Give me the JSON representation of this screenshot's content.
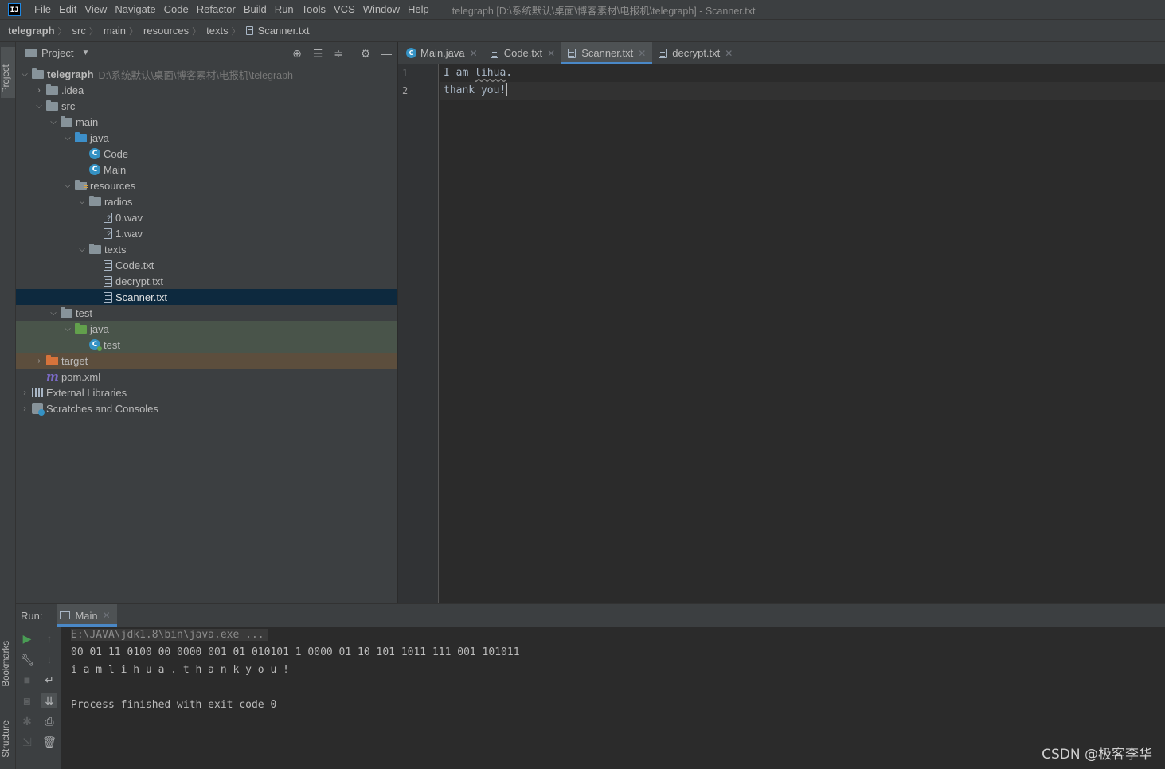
{
  "menubar": {
    "logo": "IJ",
    "items": [
      {
        "u": "F",
        "rest": "ile"
      },
      {
        "u": "E",
        "rest": "dit"
      },
      {
        "u": "V",
        "rest": "iew"
      },
      {
        "u": "N",
        "rest": "avigate"
      },
      {
        "u": "C",
        "rest": "ode"
      },
      {
        "u": "R",
        "rest": "efactor"
      },
      {
        "u": "B",
        "rest": "uild"
      },
      {
        "u": "R",
        "rest": "un",
        "pre": ""
      },
      {
        "u": "T",
        "rest": "ools"
      },
      {
        "u": "",
        "rest": "VCS"
      },
      {
        "u": "W",
        "rest": "indow"
      },
      {
        "u": "H",
        "rest": "elp"
      }
    ],
    "window_title": "telegraph [D:\\系统默认\\桌面\\博客素材\\电报机\\telegraph] - Scanner.txt"
  },
  "breadcrumb": {
    "project": "telegraph",
    "parts": [
      "src",
      "main",
      "resources",
      "texts"
    ],
    "file": "Scanner.txt"
  },
  "left_stripe": {
    "project": "Project",
    "bookmarks": "Bookmarks",
    "structure": "Structure"
  },
  "project_panel": {
    "title": "Project",
    "root_name": "telegraph",
    "root_path": "D:\\系统默认\\桌面\\博客素材\\电报机\\telegraph",
    "tree": {
      "idea": ".idea",
      "src": "src",
      "main": "main",
      "java": "java",
      "code": "Code",
      "main_class": "Main",
      "resources": "resources",
      "radios": "radios",
      "wav0": "0.wav",
      "wav1": "1.wav",
      "texts": "texts",
      "code_txt": "Code.txt",
      "decrypt_txt": "decrypt.txt",
      "scanner_txt": "Scanner.txt",
      "test": "test",
      "test_java": "java",
      "test_class": "test",
      "target": "target",
      "pom": "pom.xml",
      "ext_libs": "External Libraries",
      "scratches": "Scratches and Consoles"
    }
  },
  "editor": {
    "tabs": [
      {
        "label": "Main.java",
        "kind": "class"
      },
      {
        "label": "Code.txt",
        "kind": "file"
      },
      {
        "label": "Scanner.txt",
        "kind": "file",
        "active": true
      },
      {
        "label": "decrypt.txt",
        "kind": "file"
      }
    ],
    "line_numbers": [
      "1",
      "2"
    ],
    "line1_a": "I am ",
    "line1_b": "lihua",
    "line1_c": ".",
    "line2": "thank you!"
  },
  "run": {
    "label": "Run:",
    "tab": "Main",
    "console": {
      "cmd": "E:\\JAVA\\jdk1.8\\bin\\java.exe ...",
      "line2": "00 01 11 0100 00 0000 001 01 010101 1 0000 01 10 101 1011 111 001 101011",
      "line3": "i a m l i h u a . t h a n k y o u !",
      "line4": "",
      "line5": "Process finished with exit code 0"
    }
  },
  "watermark": "CSDN @极客李华"
}
